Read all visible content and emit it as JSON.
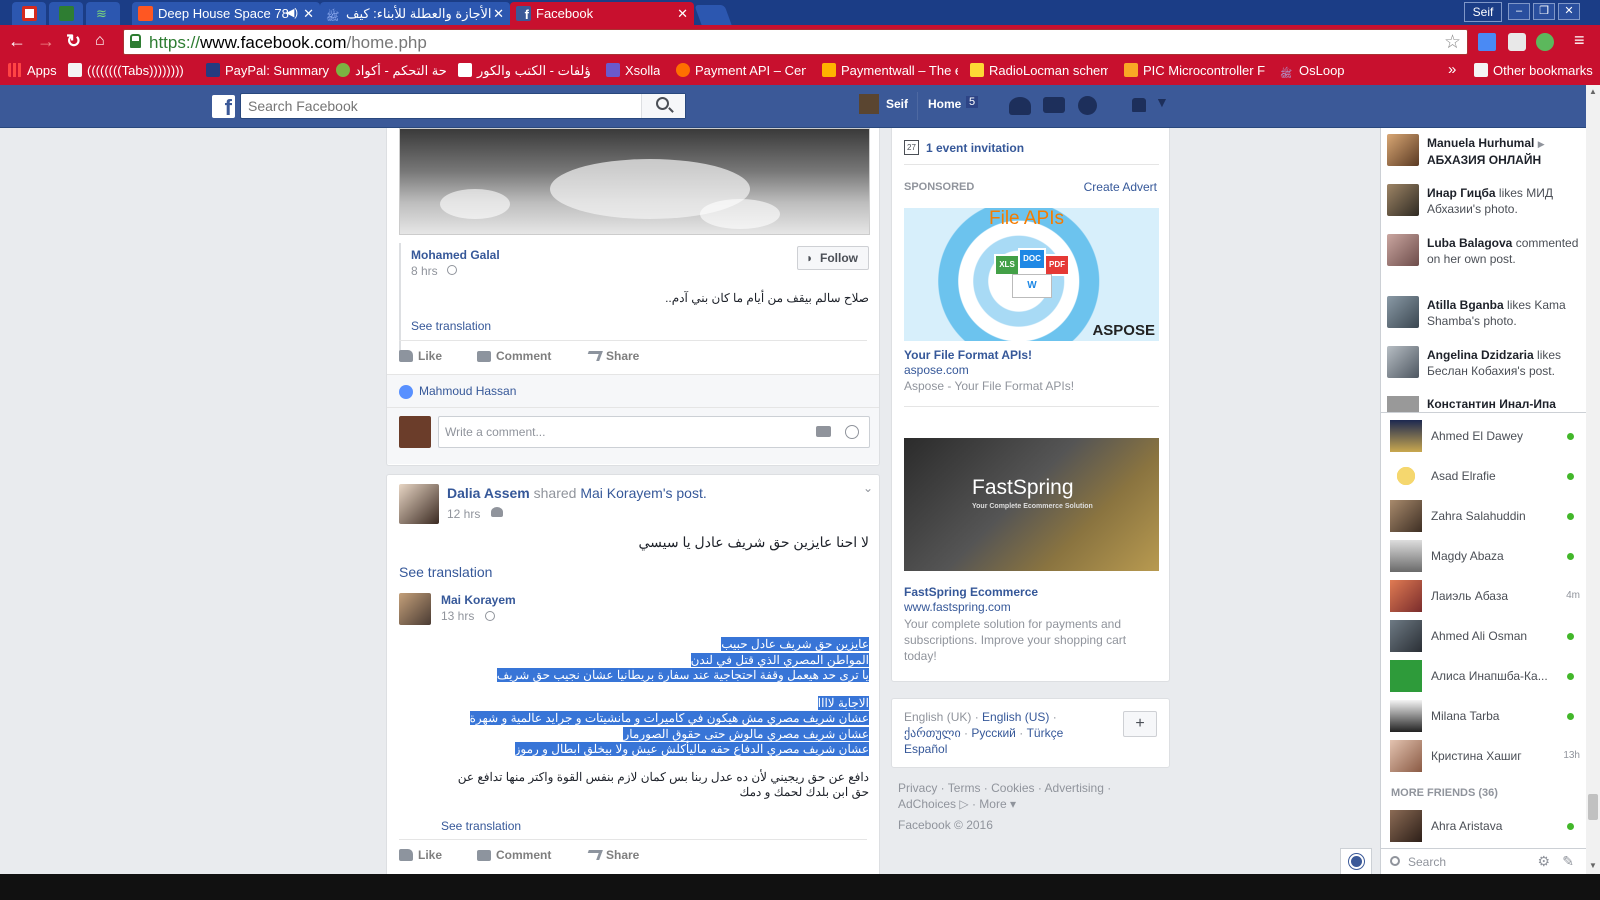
{
  "browser": {
    "tabs": [
      {
        "title": "Deep House Space 78",
        "active": false,
        "audio": true
      },
      {
        "title": "الأجازة والعطلة للأبناء: كيف",
        "active": false,
        "audio": false
      },
      {
        "title": "Facebook",
        "active": true,
        "audio": false
      }
    ],
    "profile_button": "Seif",
    "url_scheme": "https://",
    "url_host": "www.facebook.com",
    "url_path": "/home.php",
    "bookmarks": [
      {
        "label": "Apps"
      },
      {
        "label": "((((((((Tabs))))))))"
      },
      {
        "label": "PayPal: Summary"
      },
      {
        "label": "لوحة التحكم - أكواد"
      },
      {
        "label": "مؤلفات - الكتب والكور"
      },
      {
        "label": "Xsolla"
      },
      {
        "label": "Payment API – Centi"
      },
      {
        "label": "Paymentwall – The e"
      },
      {
        "label": "RadioLocman schem"
      },
      {
        "label": "PIC Microcontroller F"
      },
      {
        "label": "OsLoop"
      },
      {
        "label": "Other bookmarks"
      }
    ],
    "bookmarks_overflow": "»"
  },
  "fb_header": {
    "logo": "f",
    "search_placeholder": "Search Facebook",
    "user_name": "Seif",
    "home_label": "Home",
    "home_count": "5"
  },
  "post1": {
    "author": "Mohamed Galal",
    "time": "8 hrs",
    "follow_label": "Follow",
    "text": "صلاح سالم بيقف من أيام ما كان بني آدم..",
    "see_translation": "See translation",
    "actions": {
      "like": "Like",
      "comment": "Comment",
      "share": "Share"
    },
    "liked_by": "Mahmoud Hassan",
    "comment_placeholder": "Write a comment..."
  },
  "post2": {
    "author": "Dalia Assem",
    "shared_word": "shared",
    "orig_author": "Mai Korayem",
    "orig_suffix": "'s post.",
    "time": "12 hrs",
    "text": "لا احنا عايزين حق شريف عادل يا سيسي",
    "see_translation": "See translation",
    "inner_author": "Mai Korayem",
    "inner_time": "13 hrs",
    "inner_lines": [
      "عايزين حق شريف عادل حبيب",
      "المواطن المصري الذي قتل في لندن",
      "يا ترى حد هيعمل وقفة احتجاجية عند سفارة بريطانيا عشان نجيب حق شريف",
      "",
      "الاجابة لاااا",
      "عشان شريف مصري مش هيكون في كاميرات و مانشيتات و جرايد عالمية و شهرة",
      "عشان شريف مصري مالوش حتى حقوق الصورمار",
      "عشان شريف مصري الدفاع حقه ماليأكلش عيش ولا بيخلق ابطال و رموز",
      "دافع عن حق ريجيني لأن ده عدل ربنا بس كمان لازم بنفس القوة واكتر منها تدافع عن",
      "حق ابن بلدك لحمك و دمك"
    ],
    "inner_see_translation": "See translation",
    "actions": {
      "like": "Like",
      "comment": "Comment",
      "share": "Share"
    }
  },
  "right_col": {
    "event_count": "27",
    "event_invitation": "1 event invitation",
    "sponsored_label": "SPONSORED",
    "create_advert": "Create Advert",
    "ad1": {
      "image_title": "File APIs",
      "image_brand": "ASPOSE",
      "title": "Your File Format APIs!",
      "domain": "aspose.com",
      "desc": "Aspose - Your File Format APIs!",
      "file_types": [
        "XLS",
        "DOC",
        "PDF",
        "W"
      ]
    },
    "ad2": {
      "image_brand": "FastSpring",
      "image_tag": "Your Complete Ecommerce Solution",
      "title": "FastSpring Ecommerce",
      "domain": "www.fastspring.com",
      "desc": "Your complete solution for payments and subscriptions. Improve your shopping cart today!"
    },
    "languages": {
      "current": "English (UK)",
      "others": [
        "English (US)",
        "ქართული",
        "Русский",
        "Türkçe",
        "Español"
      ],
      "add": "+"
    },
    "footer_links": [
      "Privacy",
      "Terms",
      "Cookies",
      "Advertising",
      "AdChoices",
      "More"
    ],
    "copyright": "Facebook © 2016"
  },
  "ticker": [
    {
      "name": "Manuela Hurhumal",
      "rest": "АБХАЗИЯ ОНЛАЙН",
      "arrow": "▶"
    },
    {
      "name": "Инар Гицба",
      "rest": "likes МИД Абхазии's photo."
    },
    {
      "name": "Luba Balagova",
      "rest": "commented on her own post."
    },
    {
      "name": "Atilla Bganba",
      "rest": "likes Kama Shamba's photo."
    },
    {
      "name": "Angelina Dzidzaria",
      "rest": "likes Беслан Кобахия's post."
    },
    {
      "name": "Константин Инал-Ипа",
      "rest": ""
    }
  ],
  "chat": {
    "online": [
      {
        "name": "Ahmed El Dawey",
        "status": "online"
      },
      {
        "name": "Asad Elrafie",
        "status": "online"
      },
      {
        "name": "Zahra Salahuddin",
        "status": "online"
      },
      {
        "name": "Magdy Abaza",
        "status": "online"
      },
      {
        "name": "Лаиэль Абаза",
        "status": "4m"
      },
      {
        "name": "Ahmed Ali Osman",
        "status": "online"
      },
      {
        "name": "Алиса Инапшба-Ка...",
        "status": "online"
      },
      {
        "name": "Milana Tarba",
        "status": "online"
      },
      {
        "name": "Кристина Хашиг",
        "status": "13h"
      }
    ],
    "more_friends_label": "MORE FRIENDS (36)",
    "more": [
      {
        "name": "Ahra Aristava",
        "status": "online"
      }
    ],
    "search_placeholder": "Search"
  },
  "colors": {
    "chrome_red": "#c8102e",
    "fb_blue": "#3b5998",
    "link_blue": "#365899",
    "online_green": "#42b72a",
    "selection": "#3875d7"
  }
}
